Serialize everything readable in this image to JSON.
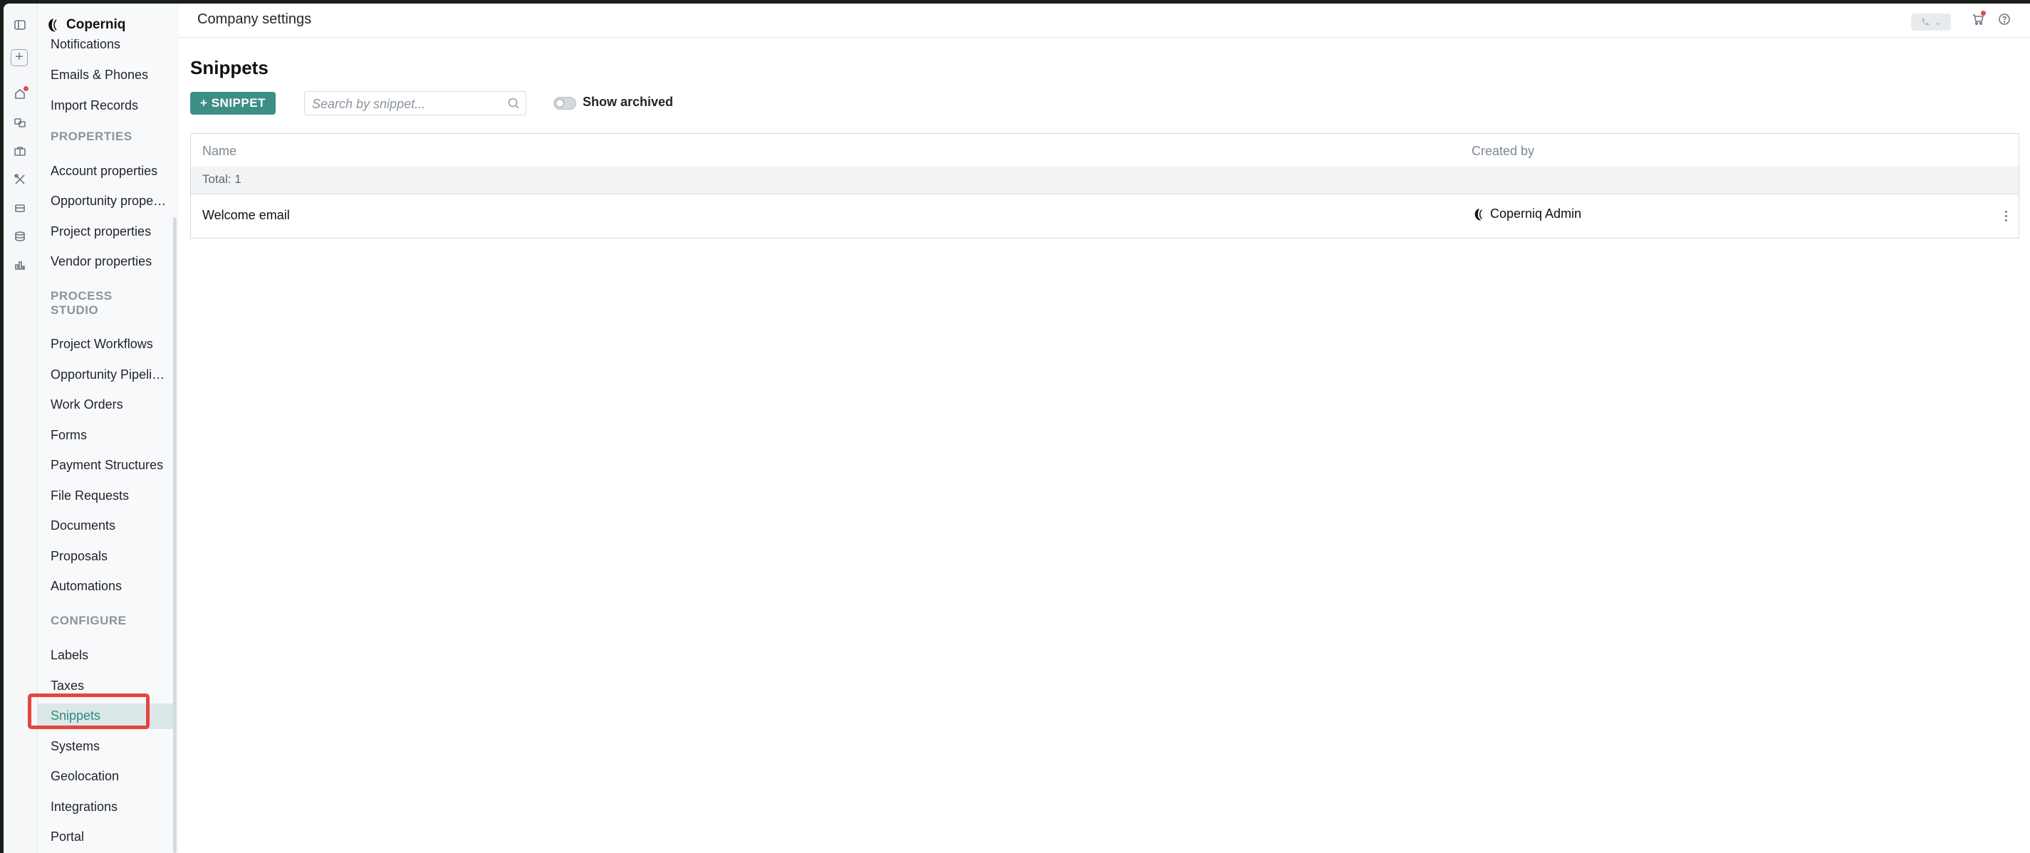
{
  "app": {
    "brand": "Coperniq"
  },
  "topbar": {
    "title": "Company settings"
  },
  "sidebar": {
    "items": [
      {
        "label": "Notifications"
      },
      {
        "label": "Emails & Phones"
      },
      {
        "label": "Import Records"
      },
      {
        "label": "PROPERTIES"
      },
      {
        "label": "Account properties"
      },
      {
        "label": "Opportunity properties"
      },
      {
        "label": "Project properties"
      },
      {
        "label": "Vendor properties"
      },
      {
        "label": "PROCESS STUDIO"
      },
      {
        "label": "Project Workflows"
      },
      {
        "label": "Opportunity Pipelines"
      },
      {
        "label": "Work Orders"
      },
      {
        "label": "Forms"
      },
      {
        "label": "Payment Structures"
      },
      {
        "label": "File Requests"
      },
      {
        "label": "Documents"
      },
      {
        "label": "Proposals"
      },
      {
        "label": "Automations"
      },
      {
        "label": "CONFIGURE"
      },
      {
        "label": "Labels"
      },
      {
        "label": "Taxes"
      },
      {
        "label": "Snippets"
      },
      {
        "label": "Systems"
      },
      {
        "label": "Geolocation"
      },
      {
        "label": "Integrations"
      },
      {
        "label": "Portal"
      }
    ],
    "active": "Snippets"
  },
  "main": {
    "title": "Snippets",
    "add_button": "+ SNIPPET",
    "search": {
      "placeholder": "Search by snippet...",
      "value": ""
    },
    "show_archived": {
      "label": "Show archived",
      "on": false
    },
    "table": {
      "columns": [
        "Name",
        "Created by"
      ],
      "total": "Total: 1",
      "rows": [
        {
          "name": "Welcome email",
          "created_by": "Coperniq Admin"
        }
      ]
    }
  },
  "colors": {
    "accent": "#3d8f86",
    "highlight": "#e5453e",
    "active_bg": "#dbe8e8"
  },
  "icons": [
    "sidebar-toggle-icon",
    "add-icon",
    "home-icon",
    "contacts-icon",
    "briefcase-icon",
    "tools-icon",
    "inbox-icon",
    "database-icon",
    "analytics-icon",
    "phone-icon",
    "cart-icon",
    "help-icon",
    "search-icon",
    "more-vertical-icon",
    "coperniq-logo-icon"
  ]
}
